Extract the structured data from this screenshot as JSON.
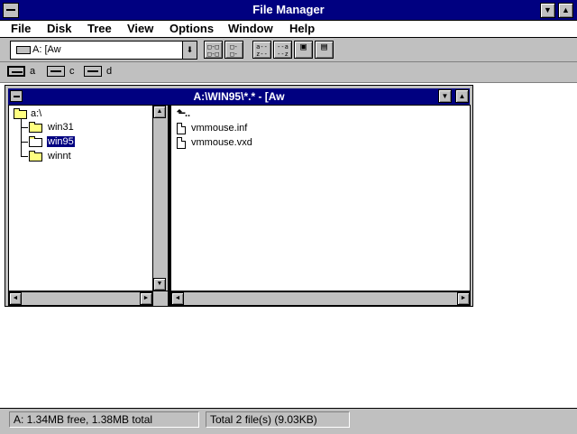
{
  "window": {
    "title": "File Manager",
    "minimize_glyph": "▼",
    "maximize_glyph": "▲"
  },
  "menu": [
    "File",
    "Disk",
    "Tree",
    "View",
    "Options",
    "Window",
    "Help"
  ],
  "toolbar": {
    "drive_selector": "A: [Aw",
    "dropdown_glyph": "⬇",
    "buttons": [
      {
        "name": "connect-network-drive",
        "label": "□-□ □-□"
      },
      {
        "name": "disconnect-network-drive",
        "label": "□- □-"
      },
      {
        "name": "sort-by-name",
        "label": "a-- z--"
      },
      {
        "name": "sort-by-type",
        "label": "--a --z"
      },
      {
        "name": "new-window",
        "label": "▣"
      },
      {
        "name": "properties",
        "label": "▤"
      }
    ]
  },
  "drives": [
    {
      "letter": "a",
      "selected": true
    },
    {
      "letter": "c",
      "selected": false
    },
    {
      "letter": "d",
      "selected": false
    }
  ],
  "child_window": {
    "title": "A:\\WIN95\\*.* - [Aw",
    "tree": [
      {
        "name": "a:\\",
        "level": 0,
        "selected": false
      },
      {
        "name": "win31",
        "level": 1,
        "selected": false
      },
      {
        "name": "win95",
        "level": 1,
        "selected": true
      },
      {
        "name": "winnt",
        "level": 1,
        "selected": false
      }
    ],
    "up_item": "..",
    "files": [
      "vmmouse.inf",
      "vmmouse.vxd"
    ]
  },
  "scroll_glyphs": {
    "up": "▲",
    "down": "▼",
    "left": "◄",
    "right": "►"
  },
  "status": {
    "free_space": "A: 1.34MB free,  1.38MB total",
    "file_total": "Total 2 file(s) (9.03KB)"
  }
}
